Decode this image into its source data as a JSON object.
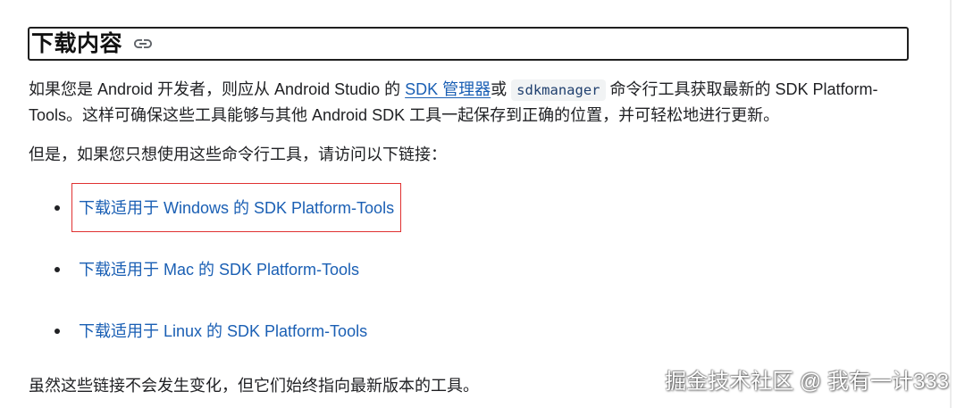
{
  "section": {
    "heading": "下载内容",
    "heading_icon": "link-icon",
    "intro": {
      "t1": "如果您是 Android 开发者，则应从 Android Studio 的 ",
      "sdk_manager_link": "SDK 管理器",
      "t2": "或 ",
      "code": "sdkmanager",
      "t3": " 命令行工具获取最新的 SDK Platform-Tools。这样可确保这些工具能够与其他 Android SDK 工具一起保存到正确的位置，并可轻松地进行更新。"
    },
    "links_intro": "但是，如果您只想使用这些命令行工具，请访问以下链接：",
    "download_links": [
      {
        "label": "下载适用于 Windows 的 SDK Platform-Tools",
        "highlighted": true
      },
      {
        "label": "下载适用于 Mac 的 SDK Platform-Tools",
        "highlighted": false
      },
      {
        "label": "下载适用于 Linux 的 SDK Platform-Tools",
        "highlighted": false
      }
    ],
    "note": "虽然这些链接不会发生变化，但它们始终指向最新版本的工具。"
  },
  "watermark": "掘金技术社区 @ 我有一计333",
  "colors": {
    "text": "#202124",
    "link": "#1a5fb4",
    "code_bg": "#f1f3f4",
    "code_text": "#1f3f6e",
    "highlight_border": "#e03131",
    "heading_border": "#1f1f1f",
    "icon": "#5f6368"
  }
}
